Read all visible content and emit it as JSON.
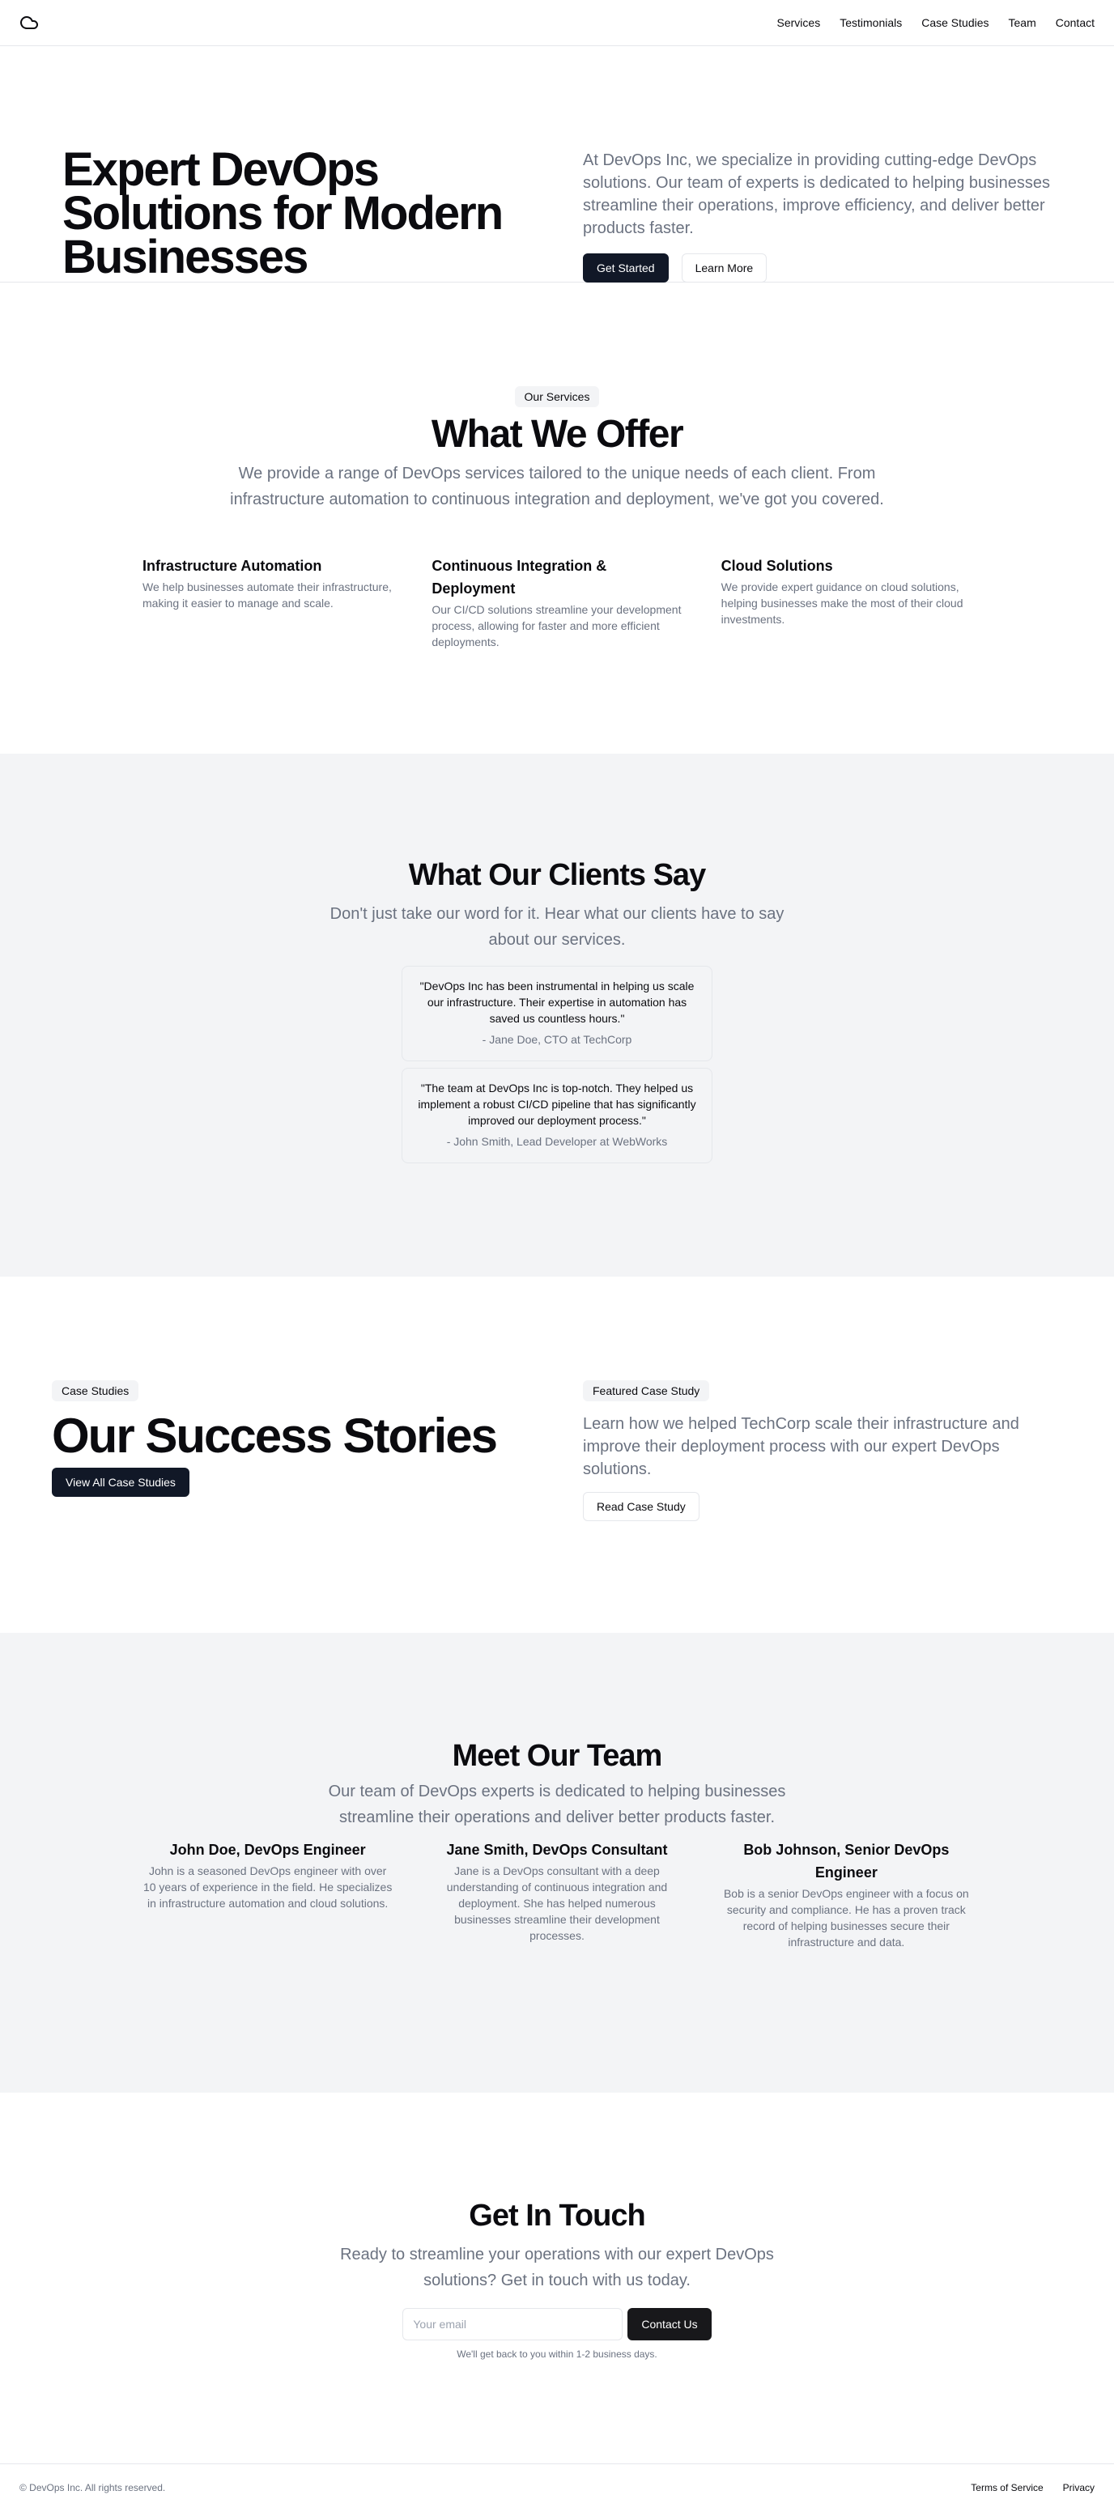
{
  "nav": {
    "logo_icon": "cloud-icon",
    "links": [
      "Services",
      "Testimonials",
      "Case Studies",
      "Team",
      "Contact"
    ]
  },
  "hero": {
    "title": "Expert DevOps Solutions for Modern Businesses",
    "description": "At DevOps Inc, we specialize in providing cutting-edge DevOps solutions. Our team of experts is dedicated to helping businesses streamline their operations, improve efficiency, and deliver better products faster.",
    "primary_button": "Get Started",
    "secondary_button": "Learn More"
  },
  "services": {
    "badge": "Our Services",
    "title": "What We Offer",
    "lead": "We provide a range of DevOps services tailored to the unique needs of each client. From infrastructure automation to continuous integration and deployment, we've got you covered.",
    "items": [
      {
        "title": "Infrastructure Automation",
        "text": "We help businesses automate their infrastructure, making it easier to manage and scale."
      },
      {
        "title": "Continuous Integration & Deployment",
        "text": "Our CI/CD solutions streamline your development process, allowing for faster and more efficient deployments."
      },
      {
        "title": "Cloud Solutions",
        "text": "We provide expert guidance on cloud solutions, helping businesses make the most of their cloud investments."
      }
    ]
  },
  "testimonials": {
    "title": "What Our Clients Say",
    "lead": "Don't just take our word for it. Hear what our clients have to say about our services.",
    "items": [
      {
        "quote": "\"DevOps Inc has been instrumental in helping us scale our infrastructure. Their expertise in automation has saved us countless hours.\"",
        "author": "- Jane Doe, CTO at TechCorp"
      },
      {
        "quote": "\"The team at DevOps Inc is top-notch. They helped us implement a robust CI/CD pipeline that has significantly improved our deployment process.\"",
        "author": "- John Smith, Lead Developer at WebWorks"
      }
    ]
  },
  "cases": {
    "badge": "Case Studies",
    "title": "Our Success Stories",
    "button": "View All Case Studies",
    "featured_badge": "Featured Case Study",
    "featured_text": "Learn how we helped TechCorp scale their infrastructure and improve their deployment process with our expert DevOps solutions.",
    "featured_button": "Read Case Study"
  },
  "team": {
    "title": "Meet Our Team",
    "lead": "Our team of DevOps experts is dedicated to helping businesses streamline their operations and deliver better products faster.",
    "members": [
      {
        "name": "John Doe, DevOps Engineer",
        "bio": "John is a seasoned DevOps engineer with over 10 years of experience in the field. He specializes in infrastructure automation and cloud solutions."
      },
      {
        "name": "Jane Smith, DevOps Consultant",
        "bio": "Jane is a DevOps consultant with a deep understanding of continuous integration and deployment. She has helped numerous businesses streamline their development processes."
      },
      {
        "name": "Bob Johnson, Senior DevOps Engineer",
        "bio": "Bob is a senior DevOps engineer with a focus on security and compliance. He has a proven track record of helping businesses secure their infrastructure and data."
      }
    ]
  },
  "contact": {
    "title": "Get In Touch",
    "lead": "Ready to streamline your operations with our expert DevOps solutions? Get in touch with us today.",
    "email_placeholder": "Your email",
    "button": "Contact Us",
    "note": "We'll get back to you within 1-2 business days."
  },
  "footer": {
    "copyright": "© DevOps Inc. All rights reserved.",
    "links": [
      "Terms of Service",
      "Privacy"
    ]
  },
  "colors": {
    "primary_button": "#111827",
    "muted_text": "#6b7280",
    "section_bg": "#f3f4f6",
    "border": "#e5e7eb"
  }
}
